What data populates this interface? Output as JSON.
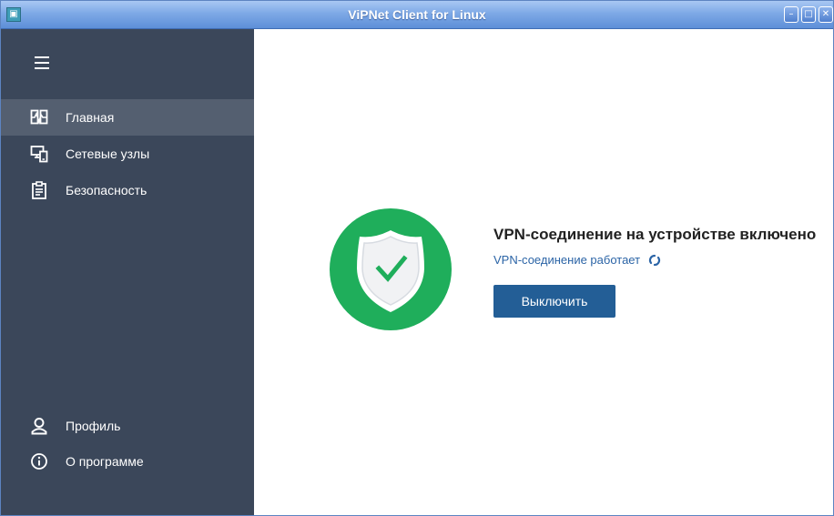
{
  "window": {
    "title": "ViPNet Client for Linux",
    "app_icon_glyph": "▣",
    "controls": [
      {
        "name": "minimize",
        "glyph": "–"
      },
      {
        "name": "maximize",
        "glyph": "□"
      },
      {
        "name": "close",
        "glyph": "✕"
      }
    ]
  },
  "sidebar": {
    "menu_icon": "hamburger-icon",
    "items": [
      {
        "label": "Главная",
        "icon": "home-dashboard-icon",
        "active": true
      },
      {
        "label": "Сетевые узлы",
        "icon": "network-nodes-icon",
        "active": false
      },
      {
        "label": "Безопасность",
        "icon": "clipboard-icon",
        "active": false
      }
    ],
    "bottom_items": [
      {
        "label": "Профиль",
        "icon": "user-icon"
      },
      {
        "label": "О программе",
        "icon": "info-icon"
      }
    ]
  },
  "main": {
    "status_icon": "shield-check-icon",
    "heading": "VPN-соединение на устройстве включено",
    "subtext": "VPN-соединение работает",
    "button_label": "Выключить"
  },
  "colors": {
    "sidebar_bg": "#3b475a",
    "sidebar_active": "#545f70",
    "status_green": "#1fae5b",
    "link_blue": "#2b64a6",
    "button_blue": "#235e96"
  }
}
